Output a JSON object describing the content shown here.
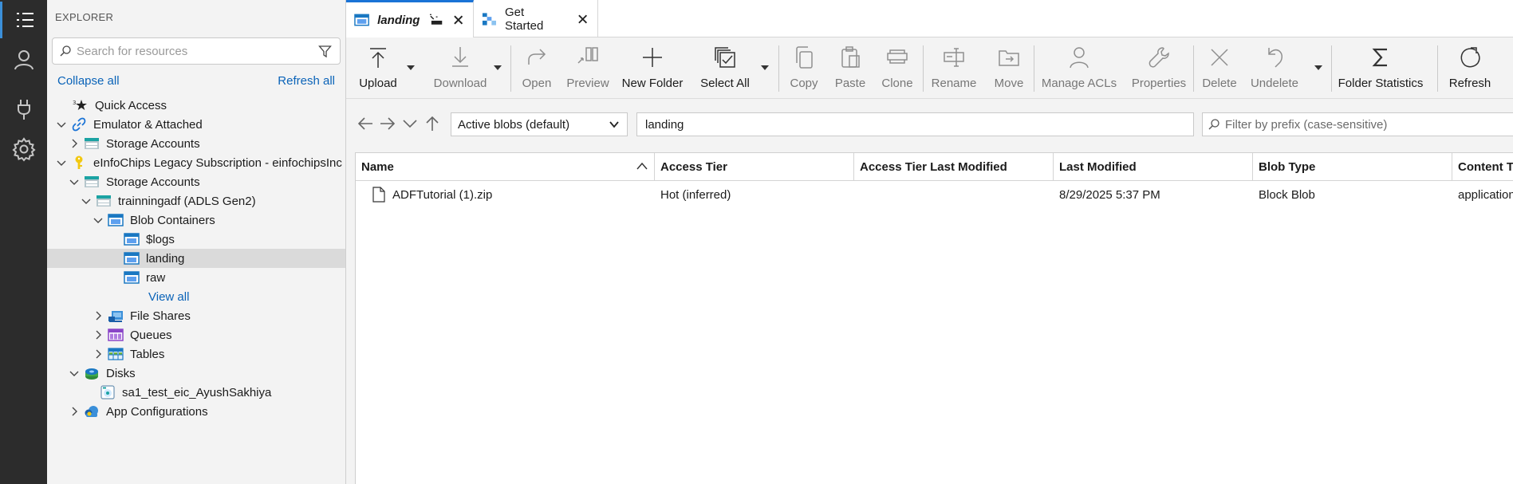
{
  "explorer": {
    "title": "EXPLORER",
    "search_placeholder": "Search for resources",
    "collapse_all": "Collapse all",
    "refresh_all": "Refresh all",
    "tree": [
      {
        "label": "Quick Access",
        "icon": "quick-access-icon"
      },
      {
        "label": "Emulator & Attached",
        "icon": "link-icon"
      },
      {
        "label": "Storage Accounts",
        "icon": "storage-account-icon"
      },
      {
        "label": "eInfoChips Legacy Subscription - einfochipsInc",
        "icon": "key-icon"
      },
      {
        "label": "Storage Accounts",
        "icon": "storage-account-icon"
      },
      {
        "label": "trainningadf (ADLS Gen2)",
        "icon": "storage-account-icon"
      },
      {
        "label": "Blob Containers",
        "icon": "blob-container-icon"
      },
      {
        "label": "$logs",
        "icon": "blob-container-icon"
      },
      {
        "label": "landing",
        "icon": "blob-container-icon"
      },
      {
        "label": "raw",
        "icon": "blob-container-icon"
      },
      {
        "label": "View all"
      },
      {
        "label": "File Shares",
        "icon": "file-share-icon"
      },
      {
        "label": "Queues",
        "icon": "queue-icon"
      },
      {
        "label": "Tables",
        "icon": "table-icon"
      },
      {
        "label": "Disks",
        "icon": "disk-icon"
      },
      {
        "label": "sa1_test_eic_AyushSakhiya",
        "icon": "disk-item-icon"
      },
      {
        "label": "App Configurations",
        "icon": "app-config-icon"
      }
    ]
  },
  "tabs": [
    {
      "label": "landing",
      "icon": "blob-container-icon"
    },
    {
      "label": "Get Started",
      "icon": "get-started-icon"
    }
  ],
  "toolbar": {
    "upload": "Upload",
    "download": "Download",
    "open": "Open",
    "preview": "Preview",
    "new_folder": "New Folder",
    "select_all": "Select All",
    "copy": "Copy",
    "paste": "Paste",
    "clone": "Clone",
    "rename": "Rename",
    "move": "Move",
    "manage_acls": "Manage ACLs",
    "properties": "Properties",
    "delete": "Delete",
    "undelete": "Undelete",
    "folder_statistics": "Folder Statistics",
    "refresh": "Refresh"
  },
  "address": {
    "view_mode": "Active blobs (default)",
    "path": "landing",
    "filter_placeholder": "Filter by prefix (case-sensitive)"
  },
  "grid": {
    "columns": [
      "Name",
      "Access Tier",
      "Access Tier Last Modified",
      "Last Modified",
      "Blob Type",
      "Content Type"
    ],
    "rows": [
      {
        "name": "ADFTutorial (1).zip",
        "access_tier": "Hot (inferred)",
        "access_tier_last_modified": "",
        "last_modified": "8/29/2025 5:37 PM",
        "blob_type": "Block Blob",
        "content_type": "application/zip"
      }
    ]
  },
  "colors": {
    "activity_bar": "#2c2c2c",
    "accent": "#1a73d6",
    "link": "#0a63b8",
    "selected_row": "#dadada"
  }
}
